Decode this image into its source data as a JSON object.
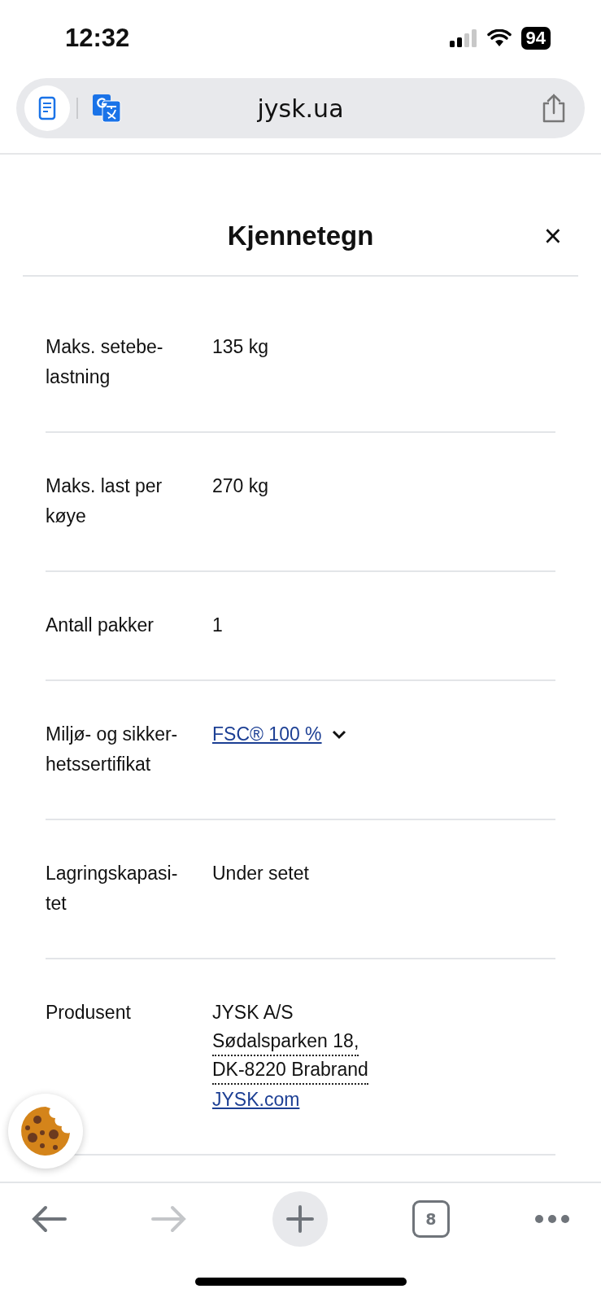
{
  "status_bar": {
    "time": "12:32",
    "battery": "94"
  },
  "address_bar": {
    "url": "jysk.ua"
  },
  "dialog": {
    "title": "Kjennetegn",
    "close": "×"
  },
  "rows": [
    {
      "label": "Maks. setebe-\nlastning",
      "value": [
        {
          "kind": "text",
          "text": "135 kg"
        }
      ]
    },
    {
      "label": "Maks. last per\nkøye",
      "value": [
        {
          "kind": "text",
          "text": "270 kg"
        }
      ]
    },
    {
      "label": "Antall pakker",
      "value": [
        {
          "kind": "text",
          "text": "1"
        }
      ]
    },
    {
      "label": "Miljø- og sikker-\nhetssertifikat",
      "value": [
        {
          "kind": "dropdown_link",
          "text": "FSC® 100 %",
          "expanded": false
        }
      ]
    },
    {
      "label": "Lagringskapasi-\ntet",
      "value": [
        {
          "kind": "text",
          "text": "Under setet"
        }
      ]
    },
    {
      "label": "Produsent",
      "value": [
        {
          "kind": "text",
          "text": "JYSK A/S"
        },
        {
          "kind": "dotted",
          "text": "Sødalsparken 18,"
        },
        {
          "kind": "dotted",
          "text": "DK-8220 Brabrand"
        },
        {
          "kind": "link",
          "text": "JYSK.com"
        }
      ]
    }
  ],
  "toolbar": {
    "tab_count": "8",
    "forward_disabled": true
  }
}
